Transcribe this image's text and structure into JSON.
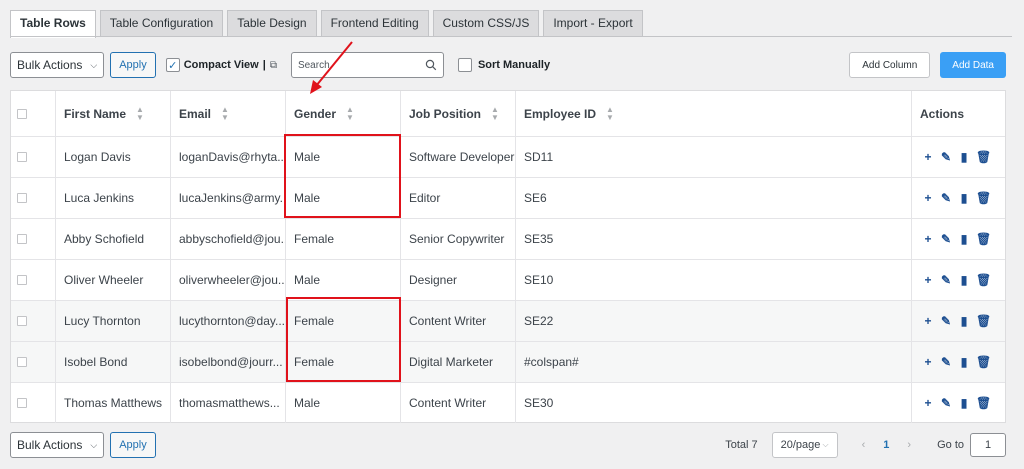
{
  "tabs": [
    "Table Rows",
    "Table Configuration",
    "Table Design",
    "Frontend Editing",
    "Custom CSS/JS",
    "Import - Export"
  ],
  "toolbar": {
    "bulk_actions": "Bulk Actions",
    "apply": "Apply",
    "compact_view": "Compact View",
    "compact_sep": "|",
    "search_placeholder": "Search",
    "sort_manually": "Sort Manually",
    "add_column": "Add Column",
    "add_data": "Add Data"
  },
  "table": {
    "headers": [
      "First Name",
      "Email",
      "Gender",
      "Job Position",
      "Employee ID",
      "Actions"
    ],
    "rows": [
      [
        "Logan Davis",
        "loganDavis@rhyta...",
        "Male",
        "Software Developer",
        "SD11"
      ],
      [
        "Luca Jenkins",
        "lucaJenkins@army...",
        "Male",
        "Editor",
        "SE6"
      ],
      [
        "Abby Schofield",
        "abbyschofield@jou...",
        "Female",
        "Senior Copywriter",
        "SE35"
      ],
      [
        "Oliver Wheeler",
        "oliverwheeler@jou...",
        "Male",
        "Designer",
        "SE10"
      ],
      [
        "Lucy Thornton",
        "lucythornton@day...",
        "Female",
        "Content Writer",
        "SE22"
      ],
      [
        "Isobel Bond",
        "isobelbond@jourr...",
        "Female",
        "Digital Marketer",
        "#colspan#"
      ],
      [
        "Thomas Matthews",
        "thomasmatthews...",
        "Male",
        "Content Writer",
        "SE30"
      ]
    ],
    "highlighted_rows": [
      4,
      5
    ]
  },
  "footer": {
    "bulk_actions": "Bulk Actions",
    "apply": "Apply",
    "total": "Total 7",
    "per_page": "20/page",
    "current_page": "1",
    "goto_label": "Go to",
    "goto_value": "1"
  },
  "icons": {
    "add": "+",
    "edit": "✎",
    "copy": "▮",
    "delete": "🗑"
  },
  "colors": {
    "accent": "#2271b1",
    "add_data_button": "#3a9ff5",
    "annotation": "#e0121b"
  }
}
